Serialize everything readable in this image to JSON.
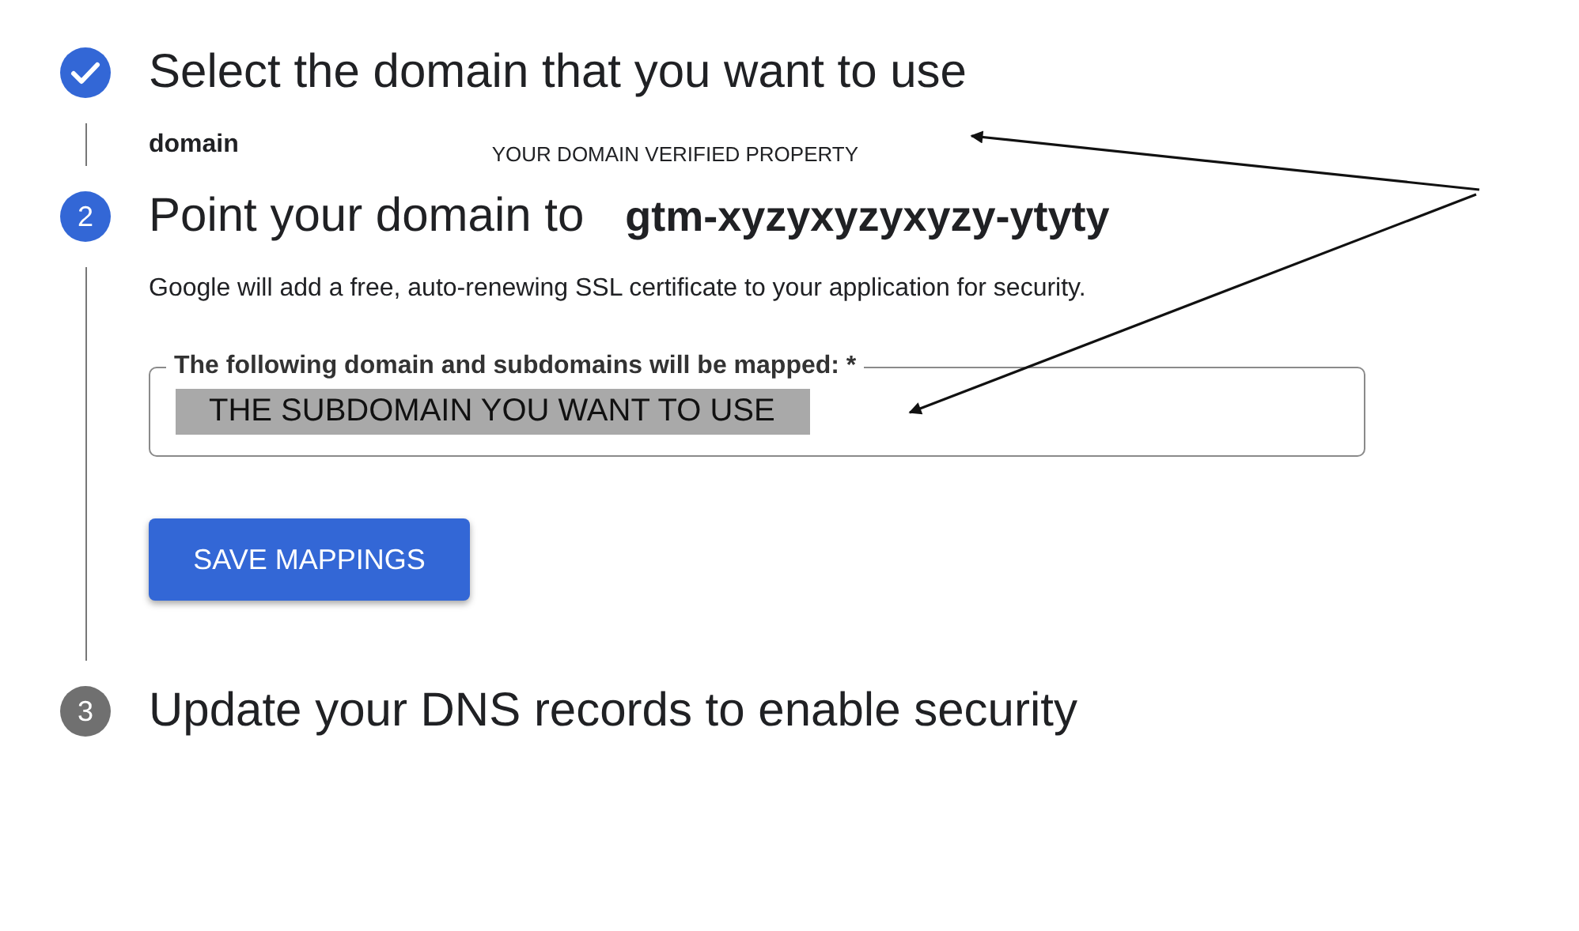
{
  "steps": [
    {
      "kind": "done",
      "title": "Select the domain that you want to use",
      "value": "domain",
      "note": "YOUR DOMAIN VERIFIED PROPERTY"
    },
    {
      "kind": "active",
      "number": "2",
      "title": "Point your domain to",
      "target": "gtm-xyzyxyzyxyzy-ytyty",
      "description": "Google will add a free, auto-renewing SSL certificate to your application for security.",
      "field": {
        "label": "The following domain and subdomains will be mapped: *",
        "value": "THE SUBDOMAIN YOU WANT TO USE"
      },
      "button": "SAVE MAPPINGS"
    },
    {
      "kind": "pending",
      "number": "3",
      "title": "Update your DNS records to enable security"
    }
  ]
}
